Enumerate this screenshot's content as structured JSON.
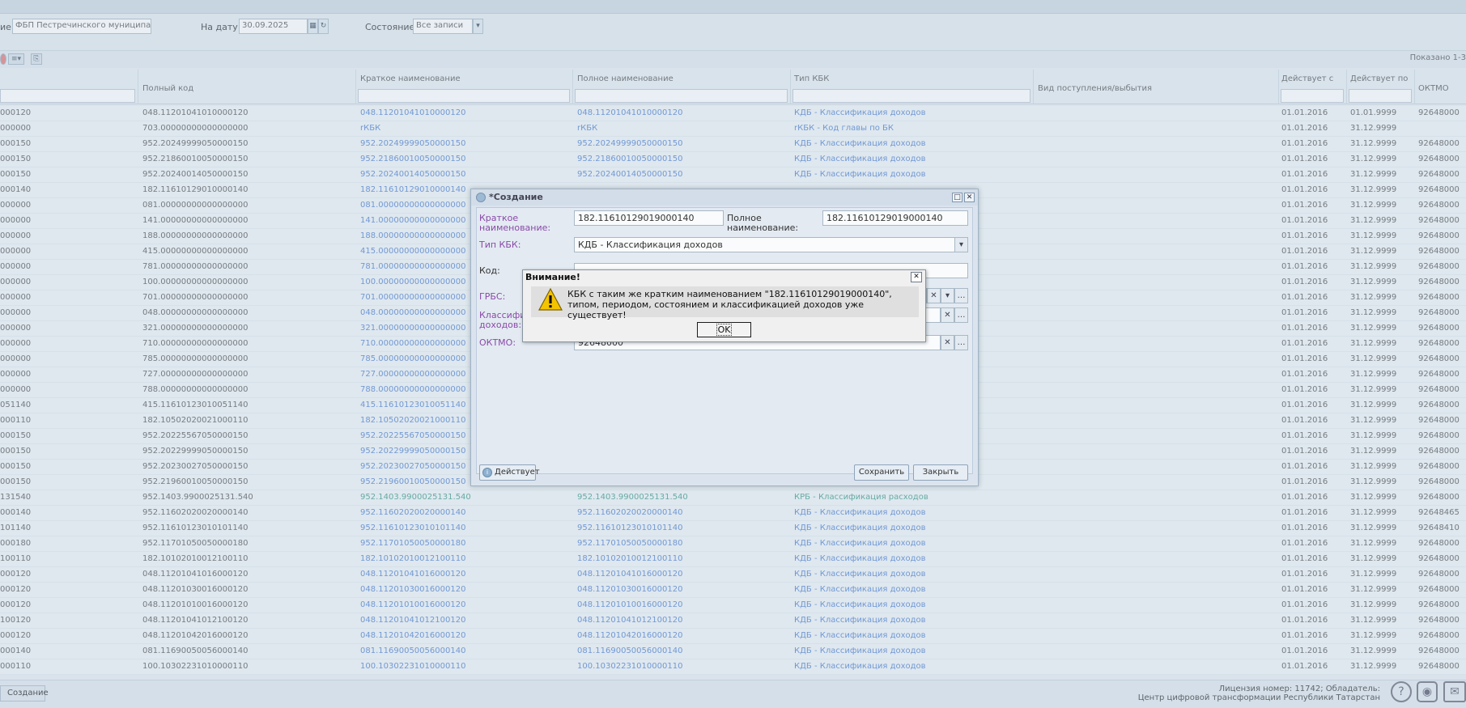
{
  "filter": {
    "org_label": "ие:",
    "org_value": "ФБП Пестречинского муниципал",
    "date_label": "На дату:",
    "date_value": "30.09.2025",
    "state_label": "Состояние:",
    "state_value": "Все записи"
  },
  "toolbar": {
    "shown_text": "Показано 1-3"
  },
  "grid": {
    "headers": {
      "full_code": "Полный код",
      "short_name": "Краткое наименование",
      "full_name": "Полное наименование",
      "kbk_type": "Тип КБК",
      "receipt_type": "Вид поступления/выбытия",
      "active_from": "Действует с",
      "active_to": "Действует по",
      "oktmo": "ОКТМО"
    },
    "rows": [
      {
        "c0": "000120",
        "c1": "048.11201041010000120",
        "c2": "048.11201041010000120",
        "c3": "048.11201041010000120",
        "c4": "КДБ - Классификация доходов",
        "c5": "01.01.2016",
        "c6": "01.01.9999",
        "c7": "92648000"
      },
      {
        "c0": "000000",
        "c1": "703.00000000000000000",
        "c2": "rКБК",
        "c3": "rКБК",
        "c4": "rКБК - Код главы по БК",
        "c5": "01.01.2016",
        "c6": "31.12.9999",
        "c7": ""
      },
      {
        "c0": "000150",
        "c1": "952.20249999050000150",
        "c2": "952.20249999050000150",
        "c3": "952.20249999050000150",
        "c4": "КДБ - Классификация доходов",
        "c5": "01.01.2016",
        "c6": "31.12.9999",
        "c7": "92648000"
      },
      {
        "c0": "000150",
        "c1": "952.21860010050000150",
        "c2": "952.21860010050000150",
        "c3": "952.21860010050000150",
        "c4": "КДБ - Классификация доходов",
        "c5": "01.01.2016",
        "c6": "31.12.9999",
        "c7": "92648000"
      },
      {
        "c0": "000150",
        "c1": "952.20240014050000150",
        "c2": "952.20240014050000150",
        "c3": "952.20240014050000150",
        "c4": "КДБ - Классификация доходов",
        "c5": "01.01.2016",
        "c6": "31.12.9999",
        "c7": "92648000"
      },
      {
        "c0": "000140",
        "c1": "182.11610129010000140",
        "c2": "182.11610129010000140",
        "c3": "",
        "c4": "",
        "c5": "01.01.2016",
        "c6": "31.12.9999",
        "c7": "92648000"
      },
      {
        "c0": "000000",
        "c1": "081.00000000000000000",
        "c2": "081.00000000000000000",
        "c3": "",
        "c4": "",
        "c5": "01.01.2016",
        "c6": "31.12.9999",
        "c7": "92648000"
      },
      {
        "c0": "000000",
        "c1": "141.00000000000000000",
        "c2": "141.00000000000000000",
        "c3": "",
        "c4": "",
        "c5": "01.01.2016",
        "c6": "31.12.9999",
        "c7": "92648000"
      },
      {
        "c0": "000000",
        "c1": "188.00000000000000000",
        "c2": "188.00000000000000000",
        "c3": "",
        "c4": "",
        "c5": "01.01.2016",
        "c6": "31.12.9999",
        "c7": "92648000"
      },
      {
        "c0": "000000",
        "c1": "415.00000000000000000",
        "c2": "415.00000000000000000",
        "c3": "",
        "c4": "",
        "c5": "01.01.2016",
        "c6": "31.12.9999",
        "c7": "92648000"
      },
      {
        "c0": "000000",
        "c1": "781.00000000000000000",
        "c2": "781.00000000000000000",
        "c3": "",
        "c4": "",
        "c5": "01.01.2016",
        "c6": "31.12.9999",
        "c7": "92648000"
      },
      {
        "c0": "000000",
        "c1": "100.00000000000000000",
        "c2": "100.00000000000000000",
        "c3": "",
        "c4": "",
        "c5": "01.01.2016",
        "c6": "31.12.9999",
        "c7": "92648000"
      },
      {
        "c0": "000000",
        "c1": "701.00000000000000000",
        "c2": "701.00000000000000000",
        "c3": "",
        "c4": "",
        "c5": "01.01.2016",
        "c6": "31.12.9999",
        "c7": "92648000"
      },
      {
        "c0": "000000",
        "c1": "048.00000000000000000",
        "c2": "048.00000000000000000",
        "c3": "",
        "c4": "",
        "c5": "01.01.2016",
        "c6": "31.12.9999",
        "c7": "92648000"
      },
      {
        "c0": "000000",
        "c1": "321.00000000000000000",
        "c2": "321.00000000000000000",
        "c3": "",
        "c4": "",
        "c5": "01.01.2016",
        "c6": "31.12.9999",
        "c7": "92648000"
      },
      {
        "c0": "000000",
        "c1": "710.00000000000000000",
        "c2": "710.00000000000000000",
        "c3": "",
        "c4": "",
        "c5": "01.01.2016",
        "c6": "31.12.9999",
        "c7": "92648000"
      },
      {
        "c0": "000000",
        "c1": "785.00000000000000000",
        "c2": "785.00000000000000000",
        "c3": "",
        "c4": "",
        "c5": "01.01.2016",
        "c6": "31.12.9999",
        "c7": "92648000"
      },
      {
        "c0": "000000",
        "c1": "727.00000000000000000",
        "c2": "727.00000000000000000",
        "c3": "",
        "c4": "",
        "c5": "01.01.2016",
        "c6": "31.12.9999",
        "c7": "92648000"
      },
      {
        "c0": "000000",
        "c1": "788.00000000000000000",
        "c2": "788.00000000000000000",
        "c3": "",
        "c4": "",
        "c5": "01.01.2016",
        "c6": "31.12.9999",
        "c7": "92648000"
      },
      {
        "c0": "051140",
        "c1": "415.11610123010051140",
        "c2": "415.11610123010051140",
        "c3": "",
        "c4": "",
        "c5": "01.01.2016",
        "c6": "31.12.9999",
        "c7": "92648000"
      },
      {
        "c0": "000110",
        "c1": "182.10502020021000110",
        "c2": "182.10502020021000110",
        "c3": "",
        "c4": "",
        "c5": "01.01.2016",
        "c6": "31.12.9999",
        "c7": "92648000"
      },
      {
        "c0": "000150",
        "c1": "952.20225567050000150",
        "c2": "952.20225567050000150",
        "c3": "",
        "c4": "",
        "c5": "01.01.2016",
        "c6": "31.12.9999",
        "c7": "92648000"
      },
      {
        "c0": "000150",
        "c1": "952.20229999050000150",
        "c2": "952.20229999050000150",
        "c3": "",
        "c4": "",
        "c5": "01.01.2016",
        "c6": "31.12.9999",
        "c7": "92648000"
      },
      {
        "c0": "000150",
        "c1": "952.20230027050000150",
        "c2": "952.20230027050000150",
        "c3": "",
        "c4": "",
        "c5": "01.01.2016",
        "c6": "31.12.9999",
        "c7": "92648000"
      },
      {
        "c0": "000150",
        "c1": "952.21960010050000150",
        "c2": "952.21960010050000150",
        "c3": "",
        "c4": "",
        "c5": "01.01.2016",
        "c6": "31.12.9999",
        "c7": "92648000"
      },
      {
        "c0": "131540",
        "c1": "952.1403.9900025131.540",
        "c2": "952.1403.9900025131.540",
        "c3": "952.1403.9900025131.540",
        "c4": "КРБ - Классификация расходов",
        "c5": "01.01.2016",
        "c6": "31.12.9999",
        "c7": "92648000",
        "teal": true
      },
      {
        "c0": "000140",
        "c1": "952.11602020020000140",
        "c2": "952.11602020020000140",
        "c3": "952.11602020020000140",
        "c4": "КДБ - Классификация доходов",
        "c5": "01.01.2016",
        "c6": "31.12.9999",
        "c7": "92648465"
      },
      {
        "c0": "101140",
        "c1": "952.11610123010101140",
        "c2": "952.11610123010101140",
        "c3": "952.11610123010101140",
        "c4": "КДБ - Классификация доходов",
        "c5": "01.01.2016",
        "c6": "31.12.9999",
        "c7": "92648410"
      },
      {
        "c0": "000180",
        "c1": "952.11701050050000180",
        "c2": "952.11701050050000180",
        "c3": "952.11701050050000180",
        "c4": "КДБ - Классификация доходов",
        "c5": "01.01.2016",
        "c6": "31.12.9999",
        "c7": "92648000"
      },
      {
        "c0": "100110",
        "c1": "182.10102010012100110",
        "c2": "182.10102010012100110",
        "c3": "182.10102010012100110",
        "c4": "КДБ - Классификация доходов",
        "c5": "01.01.2016",
        "c6": "31.12.9999",
        "c7": "92648000"
      },
      {
        "c0": "000120",
        "c1": "048.11201041016000120",
        "c2": "048.11201041016000120",
        "c3": "048.11201041016000120",
        "c4": "КДБ - Классификация доходов",
        "c5": "01.01.2016",
        "c6": "31.12.9999",
        "c7": "92648000"
      },
      {
        "c0": "000120",
        "c1": "048.11201030016000120",
        "c2": "048.11201030016000120",
        "c3": "048.11201030016000120",
        "c4": "КДБ - Классификация доходов",
        "c5": "01.01.2016",
        "c6": "31.12.9999",
        "c7": "92648000"
      },
      {
        "c0": "000120",
        "c1": "048.11201010016000120",
        "c2": "048.11201010016000120",
        "c3": "048.11201010016000120",
        "c4": "КДБ - Классификация доходов",
        "c5": "01.01.2016",
        "c6": "31.12.9999",
        "c7": "92648000"
      },
      {
        "c0": "100120",
        "c1": "048.11201041012100120",
        "c2": "048.11201041012100120",
        "c3": "048.11201041012100120",
        "c4": "КДБ - Классификация доходов",
        "c5": "01.01.2016",
        "c6": "31.12.9999",
        "c7": "92648000"
      },
      {
        "c0": "000120",
        "c1": "048.11201042016000120",
        "c2": "048.11201042016000120",
        "c3": "048.11201042016000120",
        "c4": "КДБ - Классификация доходов",
        "c5": "01.01.2016",
        "c6": "31.12.9999",
        "c7": "92648000"
      },
      {
        "c0": "000140",
        "c1": "081.11690050056000140",
        "c2": "081.11690050056000140",
        "c3": "081.11690050056000140",
        "c4": "КДБ - Классификация доходов",
        "c5": "01.01.2016",
        "c6": "31.12.9999",
        "c7": "92648000"
      },
      {
        "c0": "000110",
        "c1": "100.10302231010000110",
        "c2": "100.10302231010000110",
        "c3": "100.10302231010000110",
        "c4": "КДБ - Классификация доходов",
        "c5": "01.01.2016",
        "c6": "31.12.9999",
        "c7": "92648000"
      }
    ]
  },
  "window": {
    "title": "*Создание",
    "short_name_label": "Краткое наименование:",
    "short_name_value": "182.11610129019000140",
    "full_name_label": "Полное наименование:",
    "full_name_value": "182.11610129019000140",
    "kbk_type_label": "Тип КБК:",
    "kbk_type_value": "КДБ - Классификация доходов",
    "code_label": "Код:",
    "grbs_label": "ГРБС:",
    "classif_label": "Классифик доходов:",
    "oktmo_label": "ОКТМО:",
    "oktmo_value": "92648000",
    "active_label": "Действует",
    "save_label": "Сохранить",
    "close_label": "Закрыть"
  },
  "alert": {
    "title": "Внимание!",
    "message": "КБК с таким же кратким наименованием \"182.11610129019000140\", типом, периодом, состоянием и классификацией доходов уже существует!",
    "ok_label": "OK"
  },
  "status": {
    "task_label": "Создание",
    "license_line1": "Лицензия номер: 11742; Обладатель:",
    "license_line2": "Центр цифровой трансформации Республики Татарстан"
  }
}
